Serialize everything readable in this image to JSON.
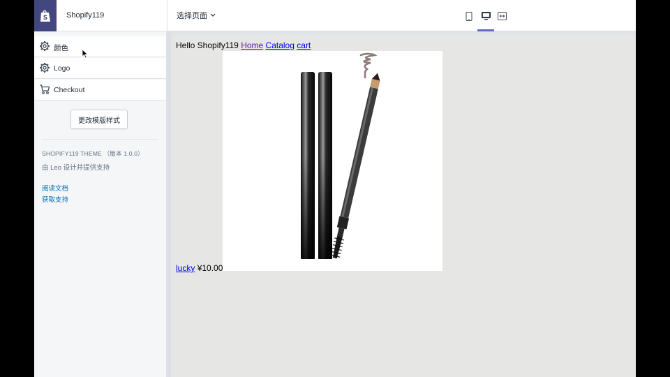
{
  "header": {
    "store_name": "Shopify119",
    "page_selector_label": "选择页面",
    "devices": [
      {
        "name": "mobile",
        "icon": "mobile-icon",
        "active": false
      },
      {
        "name": "desktop",
        "icon": "desktop-icon",
        "active": true
      },
      {
        "name": "full-width",
        "icon": "fullwidth-icon",
        "active": false
      }
    ]
  },
  "sidebar": {
    "items": [
      {
        "label": "颜色",
        "icon": "gear-icon"
      },
      {
        "label": "Logo",
        "icon": "gear-icon"
      },
      {
        "label": "Checkout",
        "icon": "cart-icon"
      }
    ],
    "change_theme_button": "更改模版样式",
    "theme_name": "SHOPIFY119 THEME （版本 1.0.0）",
    "theme_credit": "由 Leo 设计并提供支持",
    "links": [
      "阅读文档",
      "获取支持"
    ]
  },
  "preview": {
    "greeting": "Hello Shopify119",
    "nav_links": [
      "Home",
      "Catalog",
      "cart"
    ],
    "product": {
      "name": "lucky",
      "price": "¥10.00",
      "image_alt": "eyebrow-pencil-product-image"
    }
  },
  "colors": {
    "brand": "#43467f",
    "accent": "#5c6ac4",
    "link": "#006fbb",
    "preview_bg": "#e6e6e4"
  }
}
